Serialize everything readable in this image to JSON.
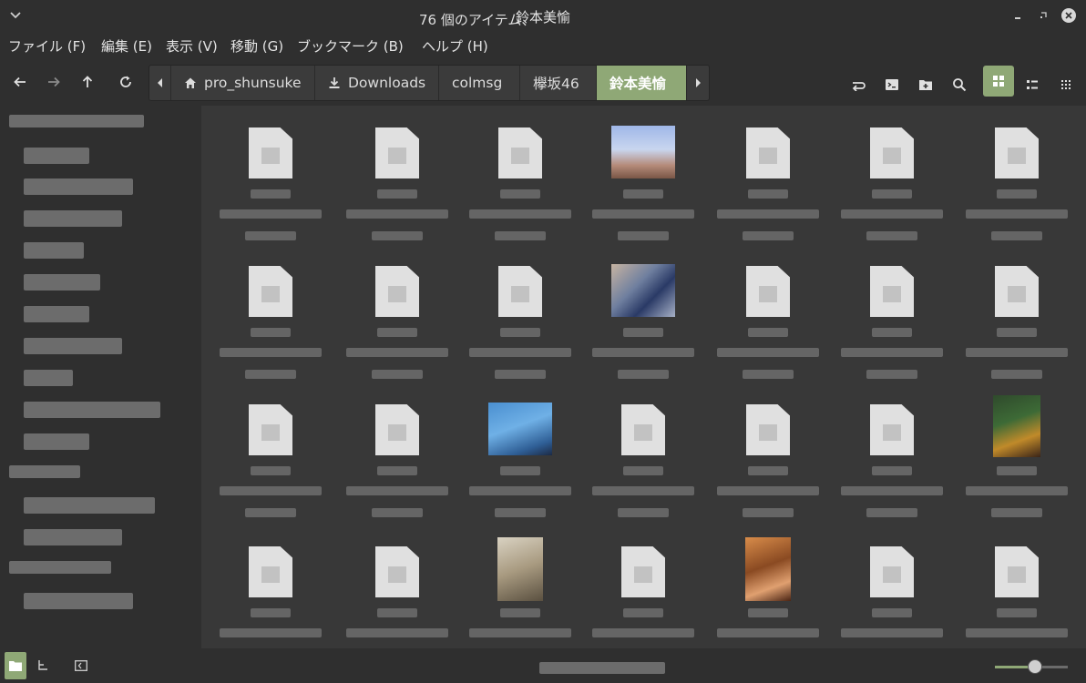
{
  "window": {
    "title": "鈴本美愉"
  },
  "menu": [
    "ファイル (F)",
    "編集 (E)",
    "表示 (V)",
    "移動 (G)",
    "ブックマーク (B)",
    "ヘルプ (H)"
  ],
  "breadcrumb": [
    "pro_shunsuke",
    "Downloads",
    "colmsg",
    "欅坂46",
    "鈴本美愉"
  ],
  "status": {
    "item_count": "76 個のアイテム、"
  },
  "zoom": {
    "level": 0.55
  },
  "colors": {
    "accent": "#8fa876",
    "background": "#383838",
    "chrome": "#2f2f2f"
  },
  "icons": {
    "back": "arrow-left-icon",
    "forward": "arrow-right-icon",
    "up": "arrow-up-icon",
    "reload": "reload-icon",
    "home": "home-icon",
    "downloads": "download-icon",
    "toggle_location": "toggle-location-icon",
    "terminal": "terminal-icon",
    "new_folder": "new-folder-icon",
    "search": "search-icon",
    "icon_view": "grid-view-icon",
    "list_view": "list-view-icon",
    "compact_view": "compact-view-icon"
  }
}
